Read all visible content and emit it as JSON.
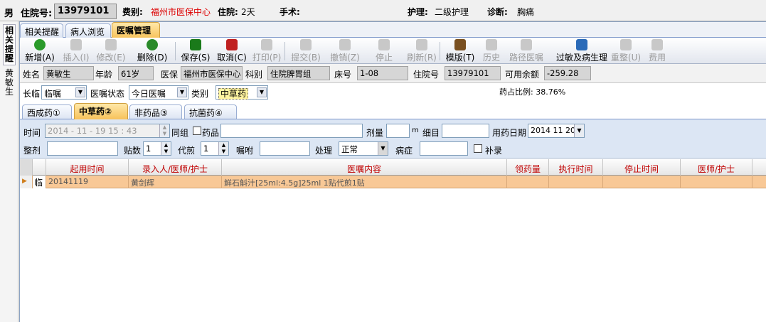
{
  "header": {
    "gender": "男",
    "admission_label": "住院号:",
    "admission_no": "13979101",
    "fee_label": "费别:",
    "fee_value": "福州市医保中心",
    "stay_label": "住院:",
    "stay_value": "2天",
    "surgery_label": "手术:",
    "nursing_label": "护理:",
    "nursing_value": "二级护理",
    "diagnosis_label": "诊断:",
    "diagnosis_value": "胸痛"
  },
  "side_tabs": [
    {
      "label": "相关提醒"
    },
    {
      "label": "黄敏生"
    }
  ],
  "main_tabs": [
    {
      "label": "相关提醒"
    },
    {
      "label": "病人浏览"
    },
    {
      "label": "医嘱管理"
    }
  ],
  "toolbar": [
    {
      "label": "新增(A)",
      "icon": "add-icon",
      "color": "#2a9a2a"
    },
    {
      "label": "插入(I)",
      "icon": "insert-icon"
    },
    {
      "label": "修改(E)",
      "icon": "edit-icon"
    },
    {
      "label": "删除(D)",
      "icon": "delete-icon",
      "color": "#2a8a2a"
    },
    {
      "label": "保存(S)",
      "icon": "save-icon",
      "color": "#1a7a1a"
    },
    {
      "label": "取消(C)",
      "icon": "undo-icon",
      "color": "#c02020"
    },
    {
      "label": "打印(P)",
      "icon": "print-icon"
    },
    {
      "label": "提交(B)",
      "icon": "submit-icon"
    },
    {
      "label": "撤销(Z)",
      "icon": "trash-icon"
    },
    {
      "label": "停止",
      "icon": "stop-icon"
    },
    {
      "label": "刷新(R)",
      "icon": "refresh-icon"
    },
    {
      "label": "模版(T)",
      "icon": "template-icon",
      "color": "#7a5020"
    },
    {
      "label": "历史",
      "icon": "history-icon"
    },
    {
      "label": "路径医嘱",
      "icon": "path-icon"
    },
    {
      "label": "过敏及病生理",
      "icon": "allergy-icon",
      "color": "#2a6ab8"
    },
    {
      "label": "重整(U)",
      "icon": "reorganize-icon"
    },
    {
      "label": "费用",
      "icon": "cost-icon"
    }
  ],
  "patient": {
    "name_label": "姓名",
    "name": "黄敏生",
    "age_label": "年龄",
    "age": "61岁",
    "insurance_label": "医保",
    "insurance": "福州市医保中心",
    "dept_label": "科别",
    "dept": "住院脾胃组",
    "bed_label": "床号",
    "bed": "1-08",
    "admission_label": "住院号",
    "admission_no": "13979101",
    "balance_label": "可用余额",
    "balance": "-259.28"
  },
  "filters": {
    "type_label": "长临",
    "type_value": "临嘱",
    "status_label": "医嘱状态",
    "status_value": "今日医嘱",
    "category_label": "类别",
    "category_value": "中草药",
    "ratio_text": "药占比例: 38.76%"
  },
  "sub_tabs": [
    {
      "label": "西成药①"
    },
    {
      "label": "中草药②"
    },
    {
      "label": "非药品③"
    },
    {
      "label": "抗菌药④"
    }
  ],
  "form": {
    "time_label": "时间",
    "time_value": "2014 - 11 - 19   15 : 43",
    "group_label": "同组",
    "drug_label": "药品",
    "dose_label": "剂量",
    "unit": "m",
    "detail_label": "细目",
    "date_label": "用药日期",
    "date_value": "2014 11 20",
    "whole_label": "整剂",
    "packs_label": "贴数",
    "packs_value": "1",
    "decoct_label": "代煎",
    "decoct_value": "1",
    "instruct_label": "嘱咐",
    "process_label": "处理",
    "process_value": "正常",
    "disease_label": "病症",
    "supplement_label": "补录"
  },
  "grid": {
    "columns": [
      "起用时间",
      "录入人/医师/护士",
      "医嘱内容",
      "领药量",
      "执行时间",
      "停止时间",
      "医师/护士"
    ],
    "rows": [
      {
        "type": "临",
        "start": "20141119",
        "entered_by": "黄剑辉",
        "content": "鲜石斛汁[25ml:4.5g]25ml  1贴代煎1贴",
        "qty": "",
        "exec_time": "",
        "stop_time": "",
        "doctor": ""
      }
    ]
  },
  "colors": {
    "accent_tab": "#f7c25a",
    "selected_row": "#f8c896",
    "header_text": "#c00000"
  }
}
